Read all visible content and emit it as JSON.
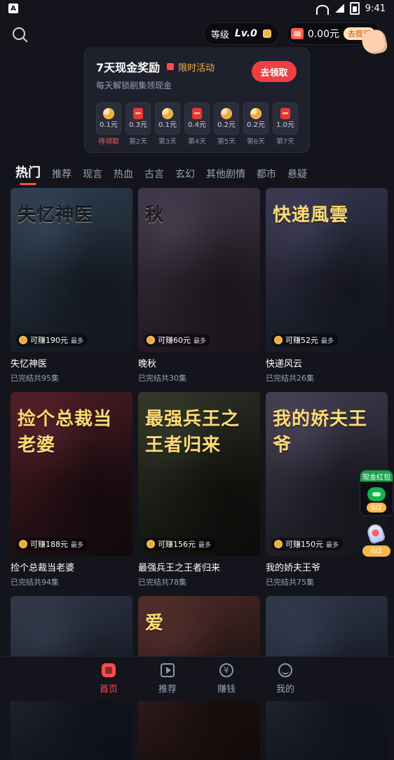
{
  "status_bar": {
    "time": "9:41",
    "sim_letter": "A"
  },
  "top": {
    "level_label": "等级",
    "level_value": "Lv.0",
    "money_amount": "0.00元",
    "withdraw_label": "去提现"
  },
  "reward": {
    "title": "7天现金奖励",
    "limited_label": "限时活动",
    "subtitle": "每天解锁剧集领现金",
    "claim_label": "去领取",
    "days": [
      {
        "amount": "0.1元",
        "label": "待领取",
        "icon": "coin-icon",
        "active": true
      },
      {
        "amount": "0.3元",
        "label": "第2天",
        "icon": "redpack-icon",
        "active": false
      },
      {
        "amount": "0.1元",
        "label": "第3天",
        "icon": "coin-icon",
        "active": false
      },
      {
        "amount": "0.4元",
        "label": "第4天",
        "icon": "redpack-icon",
        "active": false
      },
      {
        "amount": "0.2元",
        "label": "第5天",
        "icon": "coin-icon",
        "active": false
      },
      {
        "amount": "0.2元",
        "label": "第6天",
        "icon": "coin-icon",
        "active": false
      },
      {
        "amount": "1.0元",
        "label": "第7天",
        "icon": "gift-icon",
        "active": false
      }
    ]
  },
  "tabs": [
    {
      "label": "热门",
      "active": true
    },
    {
      "label": "推荐",
      "active": false
    },
    {
      "label": "现言",
      "active": false
    },
    {
      "label": "热血",
      "active": false
    },
    {
      "label": "古言",
      "active": false
    },
    {
      "label": "玄幻",
      "active": false
    },
    {
      "label": "其他剧情",
      "active": false
    },
    {
      "label": "都市",
      "active": false
    },
    {
      "label": "悬疑",
      "active": false
    }
  ],
  "cards": [
    {
      "poster_title": "失忆神医",
      "earn_text": "可赚190元",
      "earn_max": "最多",
      "name": "失忆神医",
      "episodes": "已完结共95集"
    },
    {
      "poster_title": "秋",
      "earn_text": "可赚60元",
      "earn_max": "最多",
      "name": "晚秋",
      "episodes": "已完结共30集"
    },
    {
      "poster_title": "快递風雲",
      "earn_text": "可赚52元",
      "earn_max": "最多",
      "name": "快递风云",
      "episodes": "已完结共26集"
    },
    {
      "poster_title": "捡个总裁当老婆",
      "earn_text": "可赚188元",
      "earn_max": "最多",
      "name": "捡个总裁当老婆",
      "episodes": "已完结共94集"
    },
    {
      "poster_title": "最强兵王之王者归来",
      "earn_text": "可赚156元",
      "earn_max": "最多",
      "name": "最强兵王之王者归来",
      "episodes": "已完结共78集"
    },
    {
      "poster_title": "我的娇夫王爷",
      "earn_text": "可赚150元",
      "earn_max": "最多",
      "name": "我的娇夫王爷",
      "episodes": "已完结共75集"
    },
    {
      "poster_title": "",
      "earn_text": "",
      "earn_max": "",
      "name": "",
      "episodes": ""
    },
    {
      "poster_title": "爱",
      "earn_text": "",
      "earn_max": "",
      "name": "",
      "episodes": ""
    },
    {
      "poster_title": "",
      "earn_text": "",
      "earn_max": "",
      "name": "",
      "episodes": ""
    }
  ],
  "floating": {
    "cash_redpack_label": "现金红包",
    "progress_1": "0/2",
    "progress_2": "0/2"
  },
  "bottom_nav": [
    {
      "label": "首页",
      "active": true
    },
    {
      "label": "推荐",
      "active": false
    },
    {
      "label": "赚钱",
      "active": false
    },
    {
      "label": "我的",
      "active": false
    }
  ],
  "colors": {
    "accent_red": "#ff4b4b",
    "claim_red": "#ee3f45",
    "gold": "#f0a83a",
    "green": "#16a44a"
  }
}
